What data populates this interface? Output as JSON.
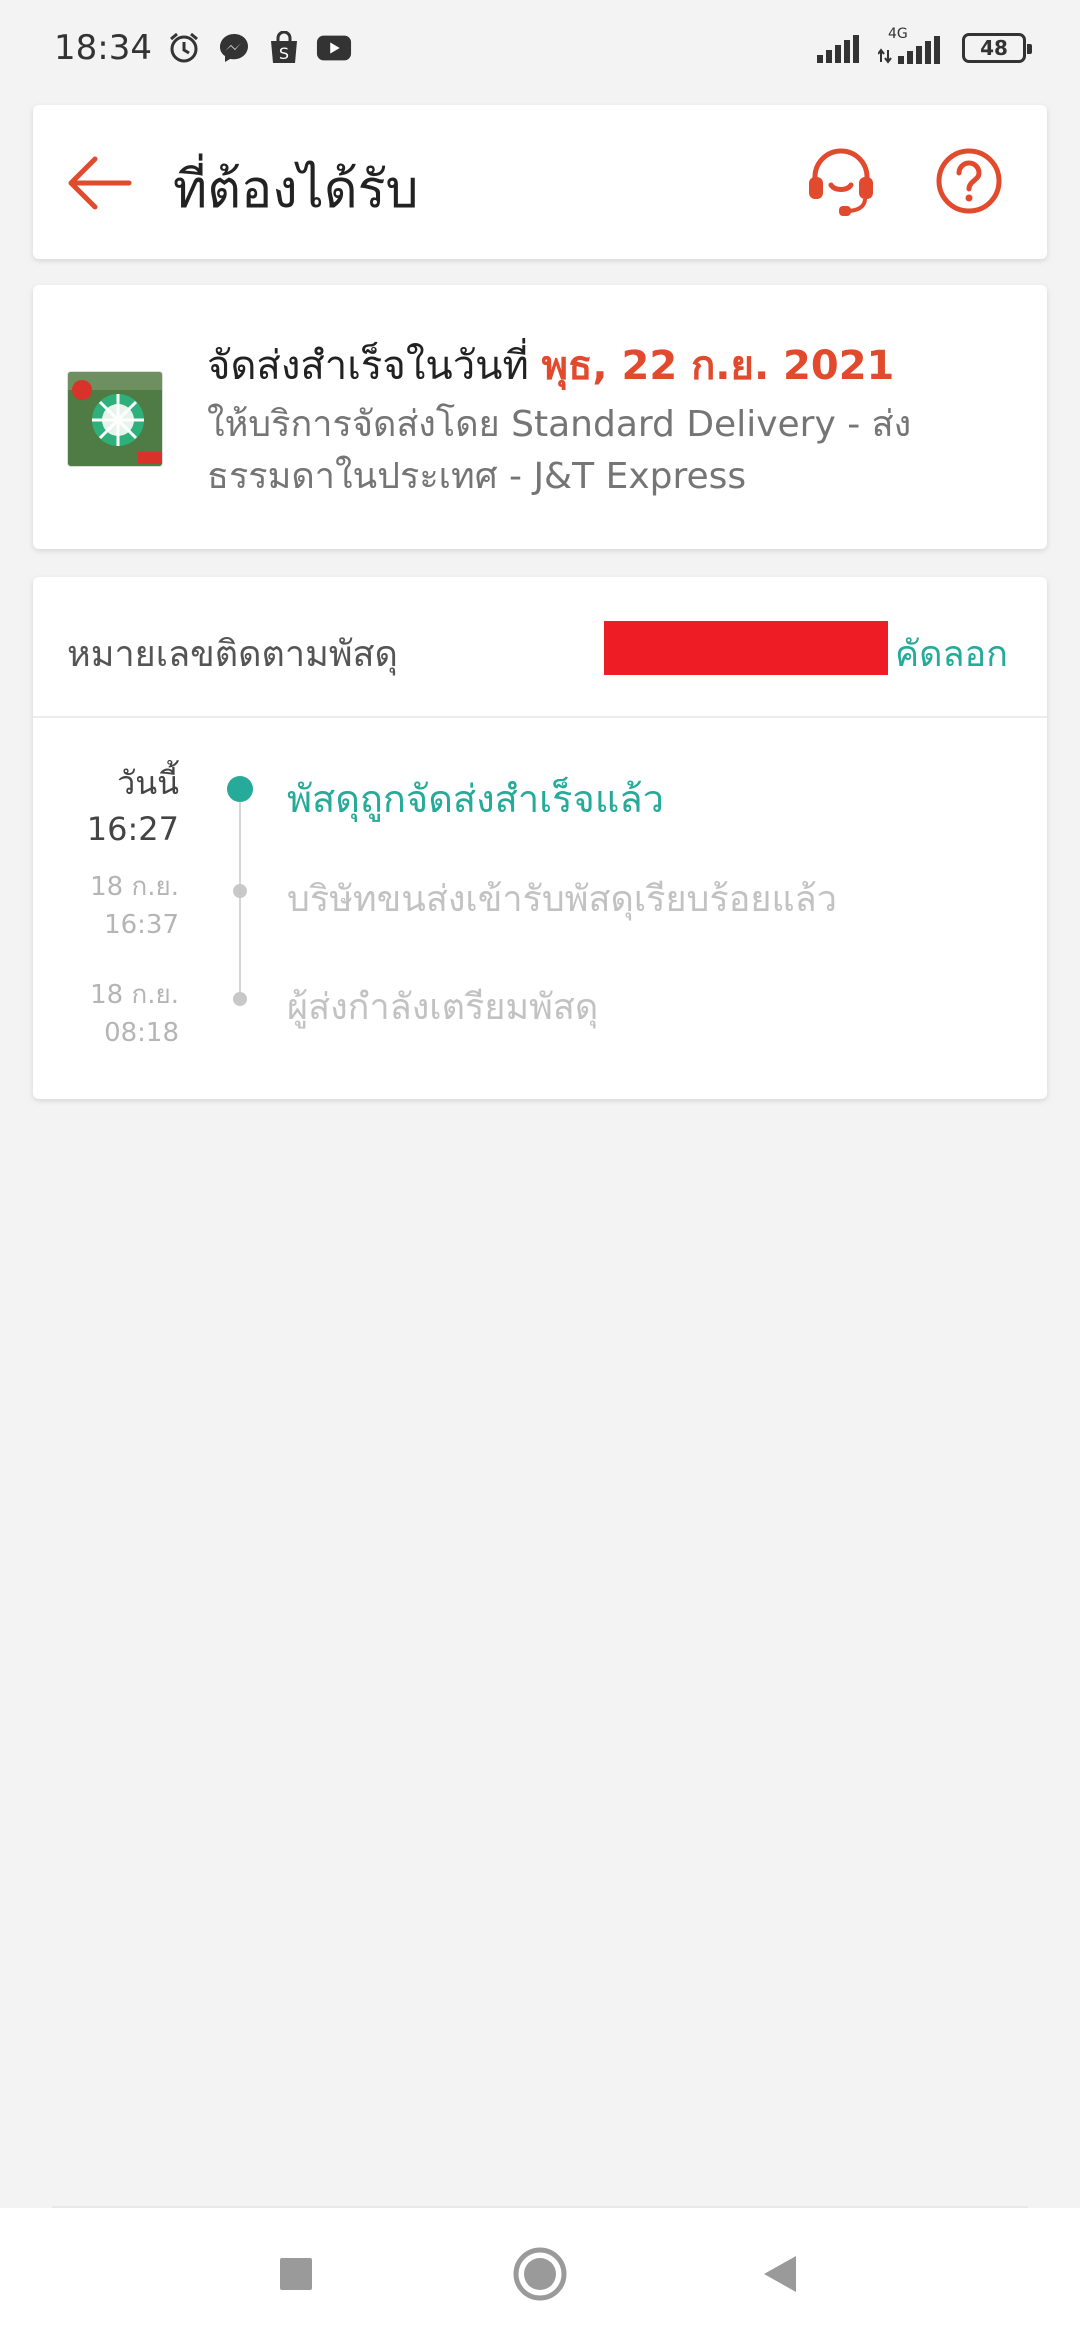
{
  "status_bar": {
    "time": "18:34",
    "network": "4G",
    "battery": "48"
  },
  "header": {
    "title": "ที่ต้องได้รับ"
  },
  "delivery": {
    "status_prefix": "จัดส่งสำเร็จในวันที่ ",
    "date": "พุธ, 22 ก.ย. 2021",
    "service_text": "ให้บริการจัดส่งโดย Standard Delivery - ส่งธรรมดาในประเทศ - J&T Express"
  },
  "tracking": {
    "label": "หมายเลขติดตามพัสดุ",
    "copy_label": "คัดลอก"
  },
  "timeline": [
    {
      "day": "วันนี้",
      "time": "16:27",
      "text": "พัสดุถูกจัดส่งสำเร็จแล้ว",
      "active": true
    },
    {
      "day": "18 ก.ย.",
      "time": "16:37",
      "text": "บริษัทขนส่งเข้ารับพัสดุเรียบร้อยแล้ว",
      "active": false
    },
    {
      "day": "18 ก.ย.",
      "time": "08:18",
      "text": "ผู้ส่งกำลังเตรียมพัสดุ",
      "active": false
    }
  ],
  "icons": {
    "back": "arrow-left-icon",
    "support": "headset-icon",
    "help": "question-circle-icon",
    "alarm": "alarm-icon",
    "messenger": "messenger-icon",
    "shop": "shopping-bag-icon",
    "youtube": "youtube-icon"
  },
  "colors": {
    "accent": "#e24a2e",
    "success": "#26aa99",
    "redaction": "#ee1c25"
  }
}
